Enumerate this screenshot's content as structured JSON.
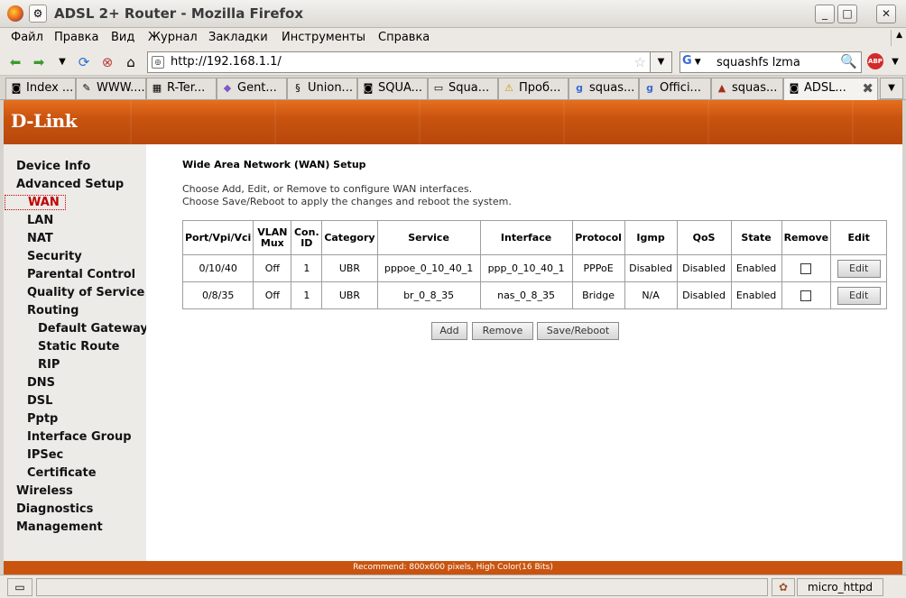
{
  "window": {
    "title": "ADSL 2+ Router - Mozilla Firefox",
    "minimize": "_",
    "maximize": "□",
    "close": "✕"
  },
  "menu": [
    "Файл",
    "Правка",
    "Вид",
    "Журнал",
    "Закладки",
    "Инструменты",
    "Справка"
  ],
  "toolbar": {
    "url": "http://192.168.1.1/",
    "search_value": "squashfs lzma",
    "search_engine": "G",
    "adblock": "ABP"
  },
  "tabs": [
    {
      "label": "Index ...",
      "icon": "page-icon"
    },
    {
      "label": "WWW....",
      "icon": "pencil-icon"
    },
    {
      "label": "R-Ter...",
      "icon": "grid-icon"
    },
    {
      "label": "Gent...",
      "icon": "gentoo-icon"
    },
    {
      "label": "Union...",
      "icon": "union-icon"
    },
    {
      "label": "SQUA...",
      "icon": "page-icon"
    },
    {
      "label": "Squa...",
      "icon": "window-icon"
    },
    {
      "label": "Проб...",
      "icon": "warning-icon"
    },
    {
      "label": "squas...",
      "icon": "google-icon"
    },
    {
      "label": "Offici...",
      "icon": "google-icon"
    },
    {
      "label": "squas...",
      "icon": "mountain-icon"
    },
    {
      "label": "ADSL...",
      "icon": "page-icon"
    }
  ],
  "brand": {
    "logo": "D-Link"
  },
  "sidebar": [
    {
      "label": "Device Info",
      "level": 0
    },
    {
      "label": "Advanced Setup",
      "level": 0
    },
    {
      "label": "WAN",
      "level": 1,
      "active": true
    },
    {
      "label": "LAN",
      "level": 1
    },
    {
      "label": "NAT",
      "level": 1
    },
    {
      "label": "Security",
      "level": 1
    },
    {
      "label": "Parental Control",
      "level": 1
    },
    {
      "label": "Quality of Service",
      "level": 1
    },
    {
      "label": "Routing",
      "level": 1
    },
    {
      "label": "Default Gateway",
      "level": 2
    },
    {
      "label": "Static Route",
      "level": 2
    },
    {
      "label": "RIP",
      "level": 2
    },
    {
      "label": "DNS",
      "level": 1
    },
    {
      "label": "DSL",
      "level": 1
    },
    {
      "label": "Pptp",
      "level": 1
    },
    {
      "label": "Interface Group",
      "level": 1
    },
    {
      "label": "IPSec",
      "level": 1
    },
    {
      "label": "Certificate",
      "level": 1
    },
    {
      "label": "Wireless",
      "level": 0
    },
    {
      "label": "Diagnostics",
      "level": 0
    },
    {
      "label": "Management",
      "level": 0
    }
  ],
  "main": {
    "heading": "Wide Area Network (WAN) Setup",
    "desc1": "Choose Add, Edit, or Remove to configure WAN interfaces.",
    "desc2": "Choose Save/Reboot to apply the changes and reboot the system.",
    "table": {
      "headers": [
        "Port/Vpi/Vci",
        "VLAN\nMux",
        "Con.\nID",
        "Category",
        "Service",
        "Interface",
        "Protocol",
        "Igmp",
        "QoS",
        "State",
        "Remove",
        "Edit"
      ],
      "rows": [
        [
          "0/10/40",
          "Off",
          "1",
          "UBR",
          "pppoe_0_10_40_1",
          "ppp_0_10_40_1",
          "PPPoE",
          "Disabled",
          "Disabled",
          "Enabled"
        ],
        [
          "0/8/35",
          "Off",
          "1",
          "UBR",
          "br_0_8_35",
          "nas_0_8_35",
          "Bridge",
          "N/A",
          "Disabled",
          "Enabled"
        ]
      ],
      "edit_label": "Edit"
    },
    "buttons": {
      "add": "Add",
      "remove": "Remove",
      "save": "Save/Reboot"
    },
    "footer": "Recommend: 800x600 pixels, High Color(16 Bits)"
  },
  "status": {
    "server": "micro_httpd"
  }
}
